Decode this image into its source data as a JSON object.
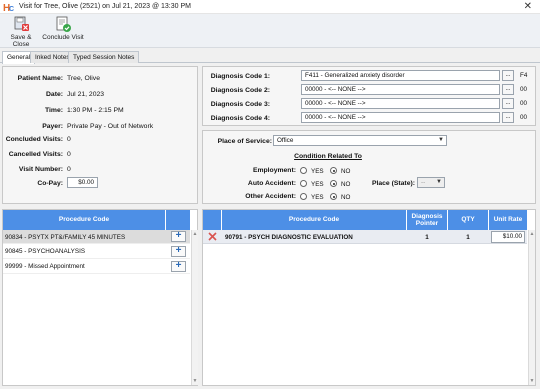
{
  "window": {
    "title": "Visit for Tree, Olive (2521) on Jul 21, 2023 @ 13:30 PM",
    "close_label": "✕"
  },
  "toolbar": {
    "save_close": "Save & Close",
    "conclude": "Conclude Visit"
  },
  "tabs": [
    "General",
    "Inked Notes",
    "Typed Session Notes"
  ],
  "patient": {
    "name_label": "Patient Name:",
    "name": "Tree, Olive",
    "date_label": "Date:",
    "date": "Jul 21, 2023",
    "time_label": "Time:",
    "time": "1:30 PM - 2:15 PM",
    "payer_label": "Payer:",
    "payer": "Private Pay - Out of Network",
    "concluded_label": "Concluded Visits:",
    "concluded": "0",
    "cancelled_label": "Cancelled Visits:",
    "cancelled": "0",
    "visit_label": "Visit Number:",
    "visit": "0",
    "copay_label": "Co-Pay:",
    "copay": "$0.00"
  },
  "diagnosis": {
    "codes": [
      {
        "label": "Diagnosis Code 1:",
        "value": "F411 - Generalized anxiety disorder",
        "pointer": "F4"
      },
      {
        "label": "Diagnosis Code 2:",
        "value": "00000 - <-- NONE -->",
        "pointer": "00"
      },
      {
        "label": "Diagnosis Code 3:",
        "value": "00000 - <-- NONE -->",
        "pointer": "00"
      },
      {
        "label": "Diagnosis Code 4:",
        "value": "00000 - <-- NONE -->",
        "pointer": "00"
      }
    ],
    "dots": "..."
  },
  "service": {
    "place_label": "Place of Service:",
    "place": "Office",
    "condition_title": "Condition Related To",
    "employment_label": "Employment:",
    "auto_label": "Auto Accident:",
    "other_label": "Other Accident:",
    "yes": "YES",
    "no": "NO",
    "state_label": "Place (State):",
    "state": "--"
  },
  "procedure_list": {
    "header": "Procedure Code",
    "items": [
      "90834 - PSYTX PT&/FAMILY 45 MINUTES",
      "90845 - PSYCHOANALYSIS",
      "99999 - Missed Appointment"
    ]
  },
  "visit_grid": {
    "headers": [
      "Procedure Code",
      "Diagnosis Pointer",
      "QTY",
      "Unit Rate"
    ],
    "rows": [
      {
        "code": "90791 - PSYCH DIAGNOSTIC EVALUATION",
        "pointer": "1",
        "qty": "1",
        "rate": "$10.00"
      }
    ]
  },
  "colors": {
    "header_blue": "#4d8fe6",
    "accent_red": "#d9534f",
    "ok_green": "#3aa64a"
  }
}
